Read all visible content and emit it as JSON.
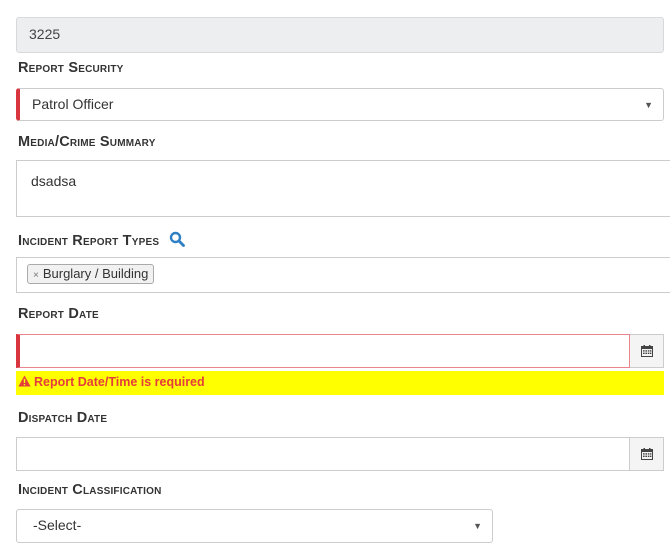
{
  "report_number": {
    "value": "3225"
  },
  "report_security": {
    "label": "Report Security",
    "selected": "Patrol Officer"
  },
  "media_crime_summary": {
    "label": "Media/Crime Summary",
    "value": "dsadsa"
  },
  "incident_report_types": {
    "label": "Incident Report Types",
    "tags": [
      {
        "remove_glyph": "×",
        "label": "Burglary / Building"
      }
    ]
  },
  "report_date": {
    "label": "Report Date",
    "value": "",
    "error": "Report Date/Time is required"
  },
  "dispatch_date": {
    "label": "Dispatch Date",
    "value": ""
  },
  "incident_classification": {
    "label": "Incident Classification",
    "selected": "-Select-"
  },
  "icons": {
    "search": "search-icon",
    "calendar": "calendar-icon",
    "warning": "warning-icon",
    "caret": "chevron-down-icon"
  },
  "colors": {
    "required_marker": "#d9353f",
    "error_background": "#ffff00",
    "error_text": "#e43d3d",
    "search_icon": "#2f7fc4",
    "readonly_background": "#eceeef"
  }
}
